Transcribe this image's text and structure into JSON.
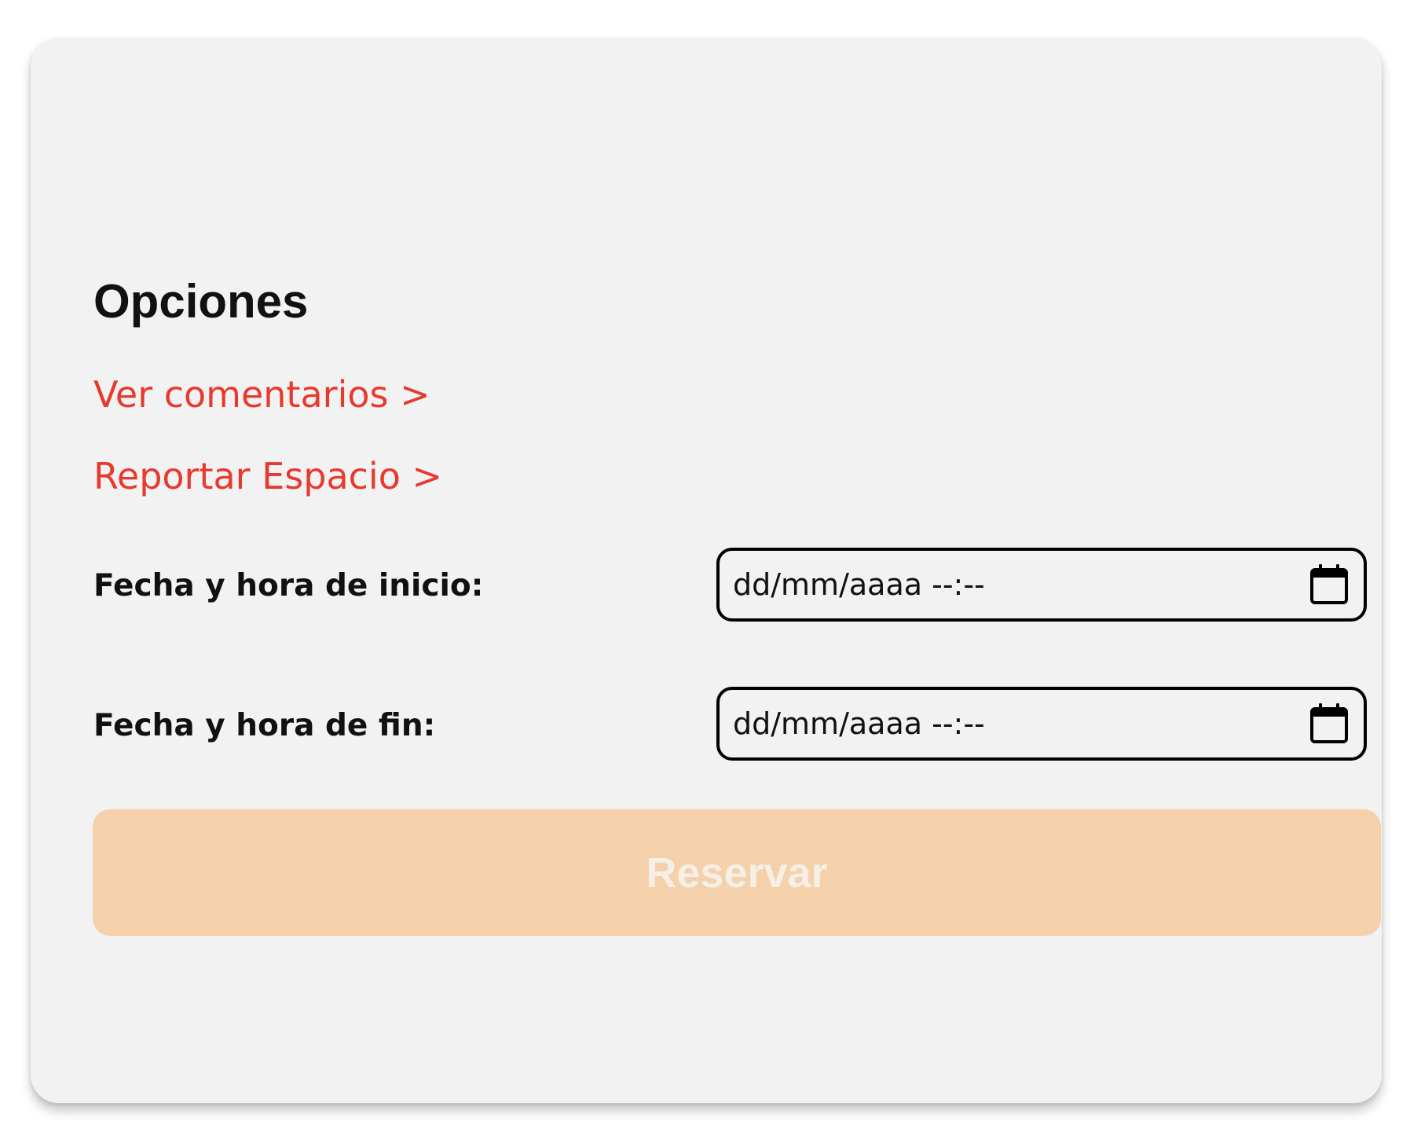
{
  "options": {
    "title": "Opciones",
    "links": [
      {
        "label": "Ver comentarios >"
      },
      {
        "label": "Reportar Espacio >"
      }
    ]
  },
  "form": {
    "start": {
      "label": "Fecha y hora de inicio:",
      "placeholder": "dd/mm/aaaa --:--",
      "icon": "calendar-icon"
    },
    "end": {
      "label": "Fecha y hora de fin:",
      "placeholder": "dd/mm/aaaa --:--",
      "icon": "calendar-icon"
    },
    "submit_label": "Reservar"
  },
  "colors": {
    "card_background": "#f2f2f2",
    "link": "#e8392e",
    "button_background": "#f4d1aa",
    "button_text": "#f5efe6",
    "text": "#111111"
  }
}
